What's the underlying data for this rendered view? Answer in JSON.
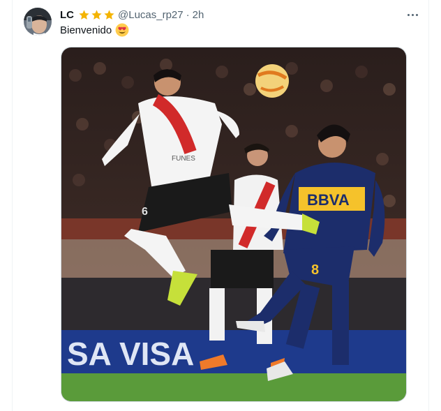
{
  "tweet": {
    "display_name": "LC",
    "star_count": 3,
    "handle": "@Lucas_rp27",
    "separator": "·",
    "time": "2h",
    "text": "Bienvenido",
    "emoji": "smiling-face-with-heart-eyes"
  },
  "media": {
    "jersey_texts": {
      "boca_sponsor": "BBVA",
      "boca_number": "8",
      "river_number": "6",
      "river_back": "FUNES",
      "ad_board": "SA VISA"
    }
  },
  "colors": {
    "star": "#f4b400",
    "text_secondary": "#536471",
    "border": "#eff3f4"
  }
}
